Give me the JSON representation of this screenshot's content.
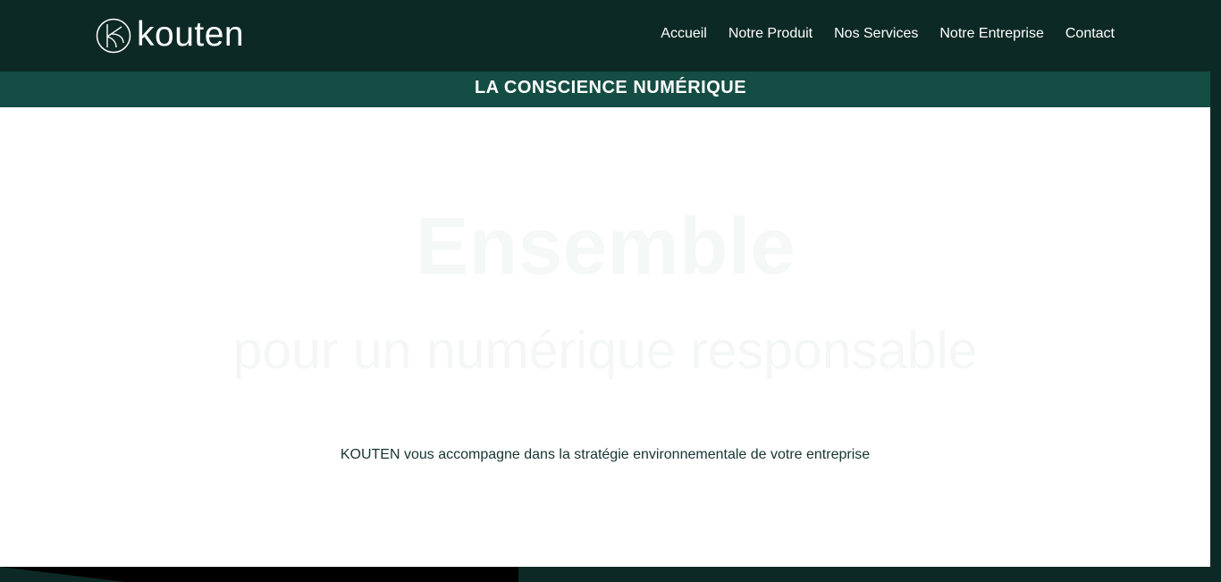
{
  "brand": {
    "name": "kouten",
    "logo_icon": "kouten-circle-logo"
  },
  "nav": {
    "items": [
      {
        "label": "Accueil"
      },
      {
        "label": "Notre Produit"
      },
      {
        "label": "Nos Services"
      },
      {
        "label": "Notre Entreprise"
      },
      {
        "label": "Contact"
      }
    ]
  },
  "banner": {
    "title": "LA CONSCIENCE NUMÉRIQUE"
  },
  "hero": {
    "title": "Ensemble",
    "subtitle": "pour un numérique responsable",
    "text": "KOUTEN vous accompagne dans la stratégie environnementale de votre entreprise"
  },
  "colors": {
    "header_bg": "#0d2926",
    "band_bg": "#144d43",
    "text_dark": "#163530",
    "hero_faint": "#f4f8f7"
  }
}
